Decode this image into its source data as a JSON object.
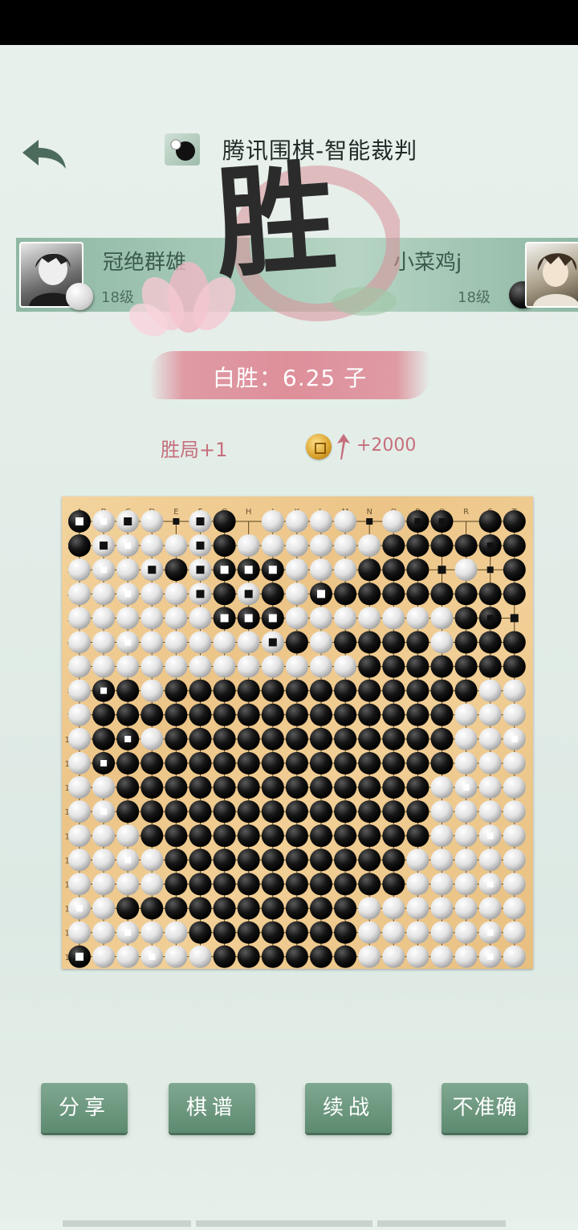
{
  "app": {
    "title": "腾讯围棋-智能裁判"
  },
  "icons": {
    "back": "back-arrow-icon",
    "logo": "go-stone-logo-icon",
    "coin": "gold-coin-icon",
    "arrow": "up-arrow-icon"
  },
  "players": {
    "left": {
      "name": "冠绝群雄",
      "level": "18级",
      "stone": "white"
    },
    "right": {
      "name": "小菜鸡j",
      "level": "18级",
      "stone": "black"
    }
  },
  "result": {
    "badge": "胜",
    "text": "白胜：6.25 子",
    "win_count": "胜局+1",
    "coin_gain": "+2000"
  },
  "board": {
    "size": 19,
    "col_labels": [
      "A",
      "B",
      "C",
      "D",
      "E",
      "F",
      "G",
      "H",
      "J",
      "K",
      "L",
      "M",
      "N",
      "O",
      "P",
      "Q",
      "R",
      "S",
      "T"
    ],
    "row_labels": [
      "1",
      "2",
      "3",
      "4",
      "5",
      "6",
      "7",
      "8",
      "9",
      "10",
      "11",
      "12",
      "13",
      "14",
      "15",
      "16",
      "17",
      "18",
      "19"
    ],
    "rows": [
      "BWWW.WB.WWWW.WBB.BB",
      "BWWWWWBWWWWWWBBBBBB",
      "WWWWBWBBBWWWBBB.W.B",
      "WWWWWWBWBWBBBBBBBBB",
      "WWWWWWBBBWWWWWWWBB.",
      "WWWWWWWWWBWBBBBWBBB",
      "WWWWWWWWWWWWBBBBBBB",
      "WBBWBBBBBBBBBBBBBWW",
      "WBBBBBBBBBBBBBBBWWW",
      "WBBWBBBBBBBBBBBBWWW",
      "WBBBBBBBBBBBBBBBWWW",
      "WWBBBBBBBBBBBBBWWWW",
      "WWBBBBBBBBBBBBBWWWW",
      "WWWBBBBBBBBBBBBWWWW",
      "WWWWBBBBBBBBBBWWWWW",
      "WWWWBBBBBBBBBBWWWWW",
      "WWBBBBBBBBBBWWWWWWW",
      "WWWWWBBBBBBBWWWWWWW",
      "BWWWWWBBBBBBWWWWWWW"
    ],
    "dead_marks": [
      [
        0,
        0
      ],
      [
        0,
        2
      ],
      [
        0,
        5
      ],
      [
        1,
        1
      ],
      [
        1,
        5
      ],
      [
        2,
        3
      ],
      [
        2,
        5
      ],
      [
        2,
        6
      ],
      [
        2,
        7
      ],
      [
        2,
        8
      ],
      [
        3,
        5
      ],
      [
        3,
        7
      ],
      [
        3,
        10
      ],
      [
        4,
        6
      ],
      [
        4,
        7
      ],
      [
        4,
        8
      ],
      [
        5,
        8
      ],
      [
        2,
        15
      ],
      [
        4,
        18
      ],
      [
        18,
        0
      ]
    ],
    "territory_marks": {
      "black": [
        [
          0,
          4
        ],
        [
          0,
          12
        ],
        [
          0,
          14
        ],
        [
          0,
          15
        ],
        [
          2,
          15
        ],
        [
          2,
          17
        ],
        [
          4,
          17
        ],
        [
          1,
          17
        ]
      ],
      "white": [
        [
          0,
          1
        ],
        [
          1,
          2
        ],
        [
          2,
          1
        ],
        [
          3,
          2
        ],
        [
          5,
          2
        ],
        [
          7,
          1
        ],
        [
          9,
          2
        ],
        [
          10,
          1
        ],
        [
          12,
          1
        ],
        [
          14,
          2
        ],
        [
          16,
          0
        ],
        [
          17,
          2
        ],
        [
          18,
          3
        ],
        [
          15,
          17
        ],
        [
          13,
          17
        ],
        [
          11,
          16
        ],
        [
          9,
          18
        ],
        [
          17,
          17
        ],
        [
          18,
          17
        ]
      ]
    }
  },
  "buttons": {
    "share": "分享",
    "record": "棋谱",
    "continue": "续战",
    "inaccurate": "不准确"
  }
}
